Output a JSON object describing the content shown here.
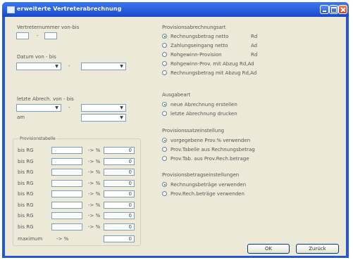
{
  "window": {
    "title": "erweiterte Vertreterabrechnung"
  },
  "left": {
    "vertreter_label": "Vertreternummer von-bis",
    "dash": "-",
    "datum_label": "Datum  von - bis",
    "abrech_label": "letzte Abrech. von - bis",
    "am_label": "am"
  },
  "provisionstabelle": {
    "title": "Provisionstabelle",
    "arrow": "-> %",
    "rows": [
      {
        "label": "bis RG",
        "value": "0"
      },
      {
        "label": "bis RG",
        "value": "0"
      },
      {
        "label": "bis RG",
        "value": "0"
      },
      {
        "label": "bis RG",
        "value": "0"
      },
      {
        "label": "bis RG",
        "value": "0"
      },
      {
        "label": "bis RG",
        "value": "0"
      },
      {
        "label": "bis RG",
        "value": "0"
      },
      {
        "label": "bis RG",
        "value": "0"
      }
    ],
    "maximum_label": "maximum",
    "maximum_value": "0"
  },
  "provisionsabrechnungsart": {
    "title": "Provisionsabrechnungsart",
    "options": [
      {
        "label": "Rechnungsbetrag netto",
        "code": "Rd",
        "selected": true
      },
      {
        "label": "Zahlungseingang netto",
        "code": "Ad",
        "selected": false
      },
      {
        "label": "Rohgewinn-Provision",
        "code": "Rd",
        "selected": false
      },
      {
        "label": "Rohgewinn-Prov. mit Abzug Rd,Ad",
        "code": "",
        "selected": false
      },
      {
        "label": "Rechnungsbetrag mit Abzug Rd,Ad",
        "code": "",
        "selected": false
      }
    ]
  },
  "ausgabeart": {
    "title": "Ausgabeart",
    "options": [
      {
        "label": "neue Abrechnung erstellen",
        "selected": true
      },
      {
        "label": "letzte Abrechnung drucken",
        "selected": false
      }
    ]
  },
  "provisionssatzeinstellung": {
    "title": "Provisionssatzeinstellung",
    "options": [
      {
        "label": "vorgegebene Prov.% verwenden",
        "selected": true
      },
      {
        "label": "Prov.Tabelle aus Rechnungsbetrag",
        "selected": false
      },
      {
        "label": "Prov.Tab. aus Prov.Rech.betrage",
        "selected": false
      }
    ]
  },
  "provisionsbetragseinstellungen": {
    "title": "Provisionsbetragseinstellungen",
    "options": [
      {
        "label": "Rechnungsbeträge verwenden",
        "selected": true
      },
      {
        "label": "Prov.Rech.beträge verwenden",
        "selected": false
      }
    ]
  },
  "buttons": {
    "ok": "OK",
    "back": "Zurück"
  },
  "icons": {
    "dropdown": "▼"
  }
}
